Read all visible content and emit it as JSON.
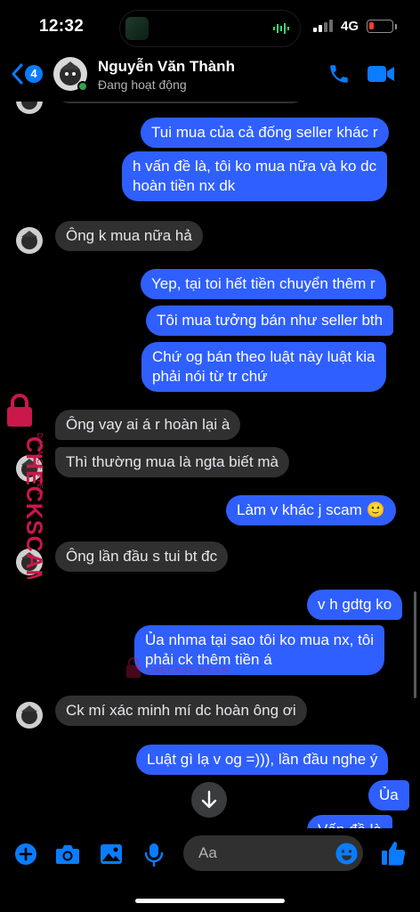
{
  "status_bar": {
    "time": "12:32",
    "network": "4G"
  },
  "header": {
    "back_badge": "4",
    "contact_name": "Nguyễn Văn Thành",
    "contact_status": "Đang hoạt động"
  },
  "messages": [
    {
      "dir": "out",
      "lines": [
        "Tui mua của cả đống seller khác r"
      ]
    },
    {
      "dir": "out",
      "lines": [
        "h vấn đề là, tôi ko mua nữa và ko dc",
        "hoàn tiền nx dk"
      ]
    },
    {
      "dir": "in",
      "lines": [
        "Ông k mua nữa hả"
      ]
    },
    {
      "dir": "out",
      "lines": [
        "Yep, tại toi hết tiền chuyển thêm r"
      ]
    },
    {
      "dir": "out",
      "lines": [
        "Tôi mua tưởng bán như seller bth"
      ]
    },
    {
      "dir": "out",
      "lines": [
        "Chứ og bán theo luật này luật kia",
        "phải nói từ tr chứ"
      ]
    },
    {
      "dir": "in",
      "lines": [
        "Ông vay ai á r hoàn lại à"
      ]
    },
    {
      "dir": "in",
      "lines": [
        "Thì thường mua là ngta biết mà"
      ]
    },
    {
      "dir": "out",
      "lines": [
        "Làm v khác j scam 🙂"
      ]
    },
    {
      "dir": "in",
      "lines": [
        "Ông lần đầu s tui bt đc"
      ]
    },
    {
      "dir": "out",
      "lines": [
        "v h gdtg ko"
      ]
    },
    {
      "dir": "out",
      "lines": [
        "Ủa nhma tại sao tôi ko mua nx, tôi",
        "phải ck thêm tiền á"
      ]
    },
    {
      "dir": "in",
      "lines": [
        "Ck mí xác minh mí dc hoàn ông ơi"
      ]
    },
    {
      "dir": "out",
      "lines": [
        "Luật gì lạ v og =))), lần đầu nghe ý"
      ]
    },
    {
      "dir": "out",
      "lines": [
        "Ủa"
      ]
    },
    {
      "dir": "out",
      "lines": [
        "Vấn đề là"
      ]
    }
  ],
  "watermark": {
    "brand": "CHECKSCAM.VN",
    "sub": "DATA CENTER"
  },
  "composer": {
    "placeholder": "Aa"
  },
  "colors": {
    "outgoing": "#2f5fff",
    "incoming": "#303030",
    "accent": "#0a7cff",
    "online": "#31a24c"
  }
}
